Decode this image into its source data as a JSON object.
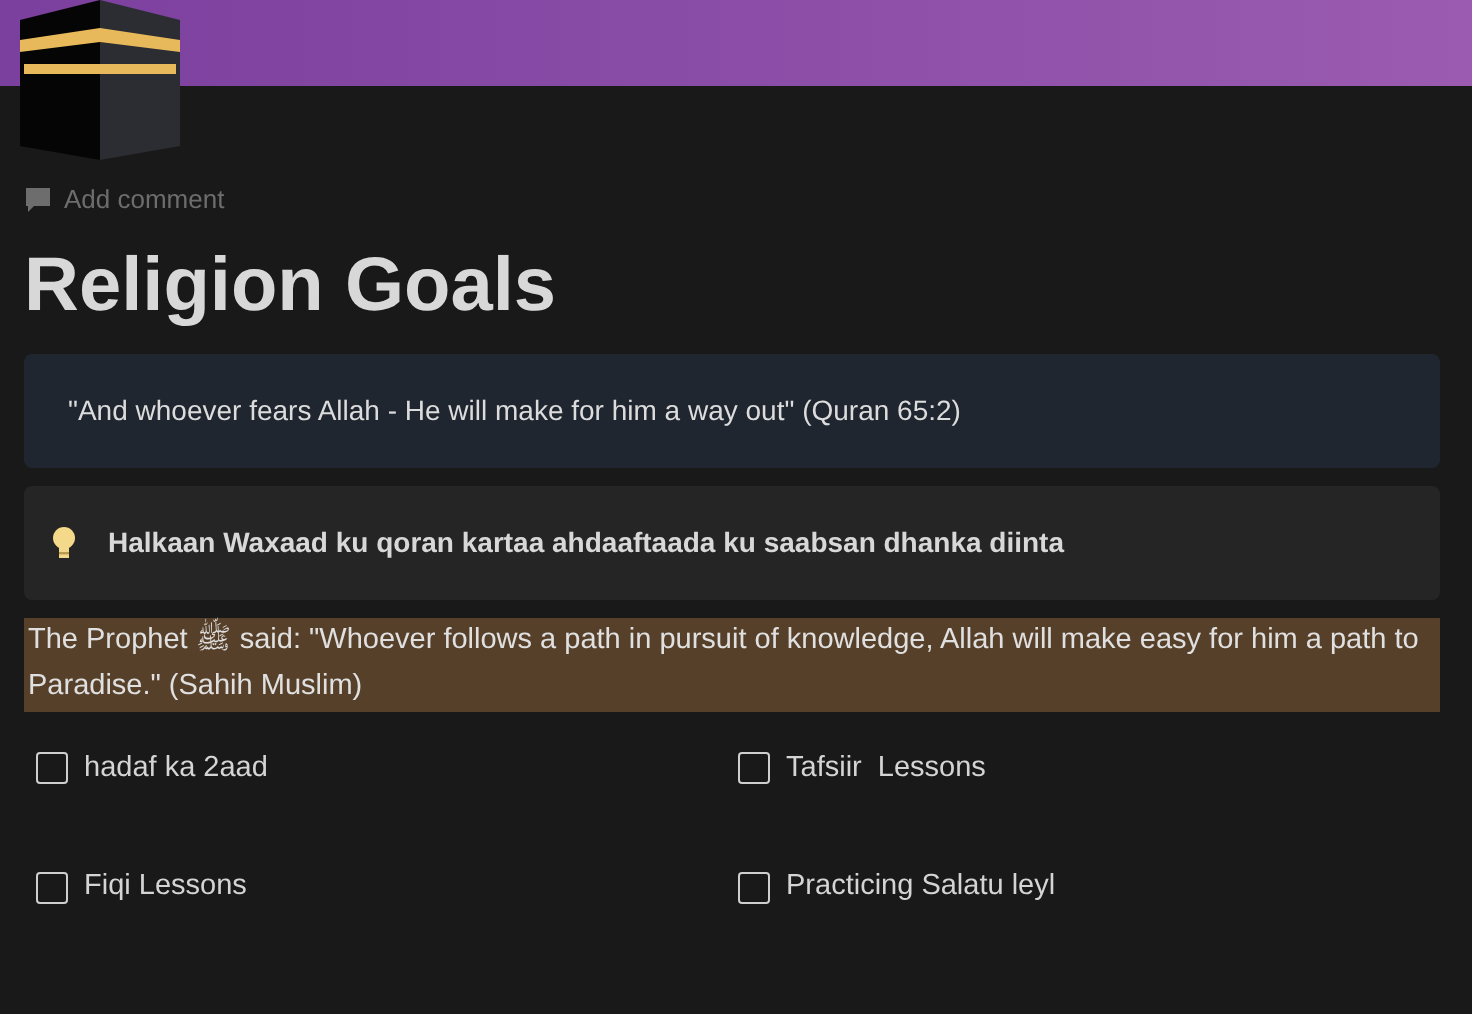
{
  "add_comment": "Add comment",
  "title": "Religion Goals",
  "callouts": [
    {
      "kind": "quote",
      "text": "\"And whoever fears Allah - He will make for him a way out\" (Quran 65:2)"
    },
    {
      "kind": "bulb",
      "text": "Halkaan Waxaad ku qoran kartaa ahdaaftaada ku saabsan dhanka diinta"
    }
  ],
  "highlight": "The Prophet ﷺ said: \"Whoever follows a path in pursuit of knowledge, Allah will make easy for him a path to Paradise.\" (Sahih Muslim)",
  "todos": [
    {
      "label": "hadaf ka 2aad",
      "checked": false
    },
    {
      "label": "Tafsiir  Lessons",
      "checked": false
    },
    {
      "label": "Fiqi Lessons",
      "checked": false
    },
    {
      "label": "Practicing Salatu leyl",
      "checked": false
    }
  ]
}
